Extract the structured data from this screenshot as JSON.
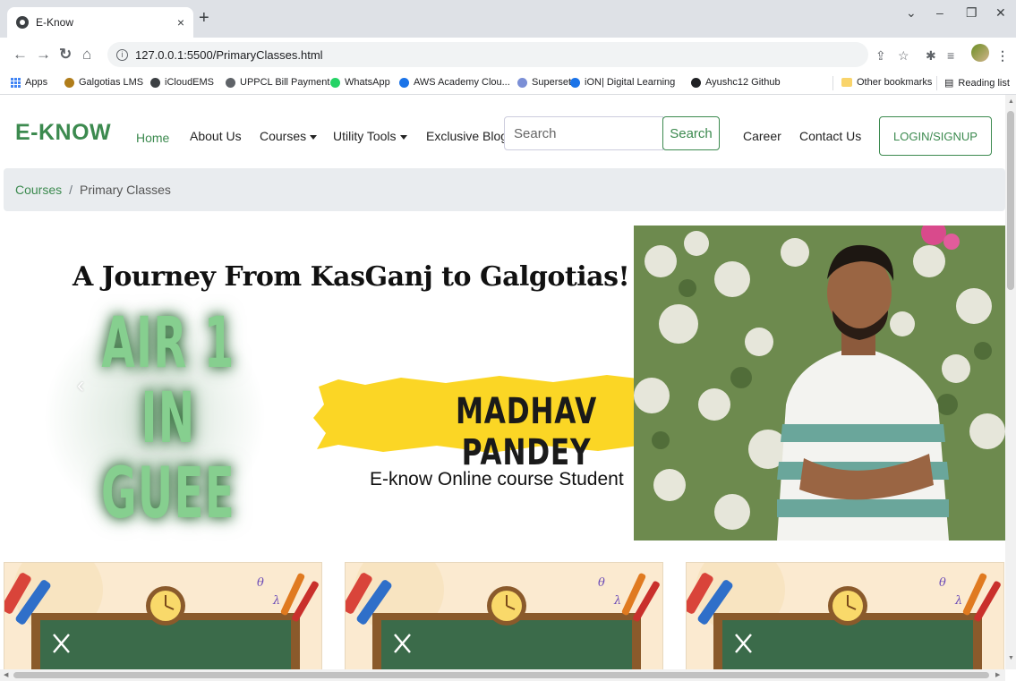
{
  "browser": {
    "tab_title": "E-Know",
    "tab_close": "×",
    "new_tab": "+",
    "url": "127.0.0.1:5500/PrimaryClasses.html",
    "url_info": "i",
    "bookmarks": [
      {
        "label": "Apps",
        "icon": "apps-grid-icon"
      },
      {
        "label": "Galgotias LMS",
        "icon": "galgotias-icon",
        "color": "#b07d1a"
      },
      {
        "label": "iCloudEMS",
        "icon": "icloudems-icon",
        "color": "#3c4043"
      },
      {
        "label": "UPPCL Bill Payment",
        "icon": "uppcl-icon",
        "color": "#5f6368"
      },
      {
        "label": "WhatsApp",
        "icon": "whatsapp-icon",
        "color": "#25d366"
      },
      {
        "label": "AWS Academy Clou...",
        "icon": "aws-icon",
        "color": "#1a73e8"
      },
      {
        "label": "Superset",
        "icon": "superset-icon",
        "color": "#7b8fd6"
      },
      {
        "label": "iON| Digital Learning",
        "icon": "ion-icon",
        "color": "#1a73e8"
      },
      {
        "label": "Ayushc12 Github",
        "icon": "github-icon",
        "color": "#202124"
      }
    ],
    "other_bookmarks": "Other bookmarks",
    "reading_list": "Reading list"
  },
  "nav": {
    "brand": "E-KNOW",
    "home": "Home",
    "about": "About Us",
    "courses": "Courses",
    "utility": "Utility Tools",
    "blogs": "Exclusive Blogs",
    "search_placeholder": "Search",
    "search_button": "Search",
    "career": "Career",
    "contact": "Contact Us",
    "login": "LOGIN/SIGNUP"
  },
  "breadcrumb": {
    "parent": "Courses",
    "separator": "/",
    "current": "Primary Classes"
  },
  "hero": {
    "title": "A Journey From KasGanj to Galgotias!",
    "rank_line1": "AIR 1",
    "rank_line2": "IN GUEE",
    "name": "MADHAV PANDEY",
    "subtitle": "E-know Online course Student",
    "prev_arrow": "‹"
  },
  "colors": {
    "brand_green": "#3c8a4f",
    "rank_green": "#86cf8f",
    "brush_yellow": "#fbd625",
    "card_bg": "#fbead0",
    "chalkboard": "#3b6b4a"
  }
}
